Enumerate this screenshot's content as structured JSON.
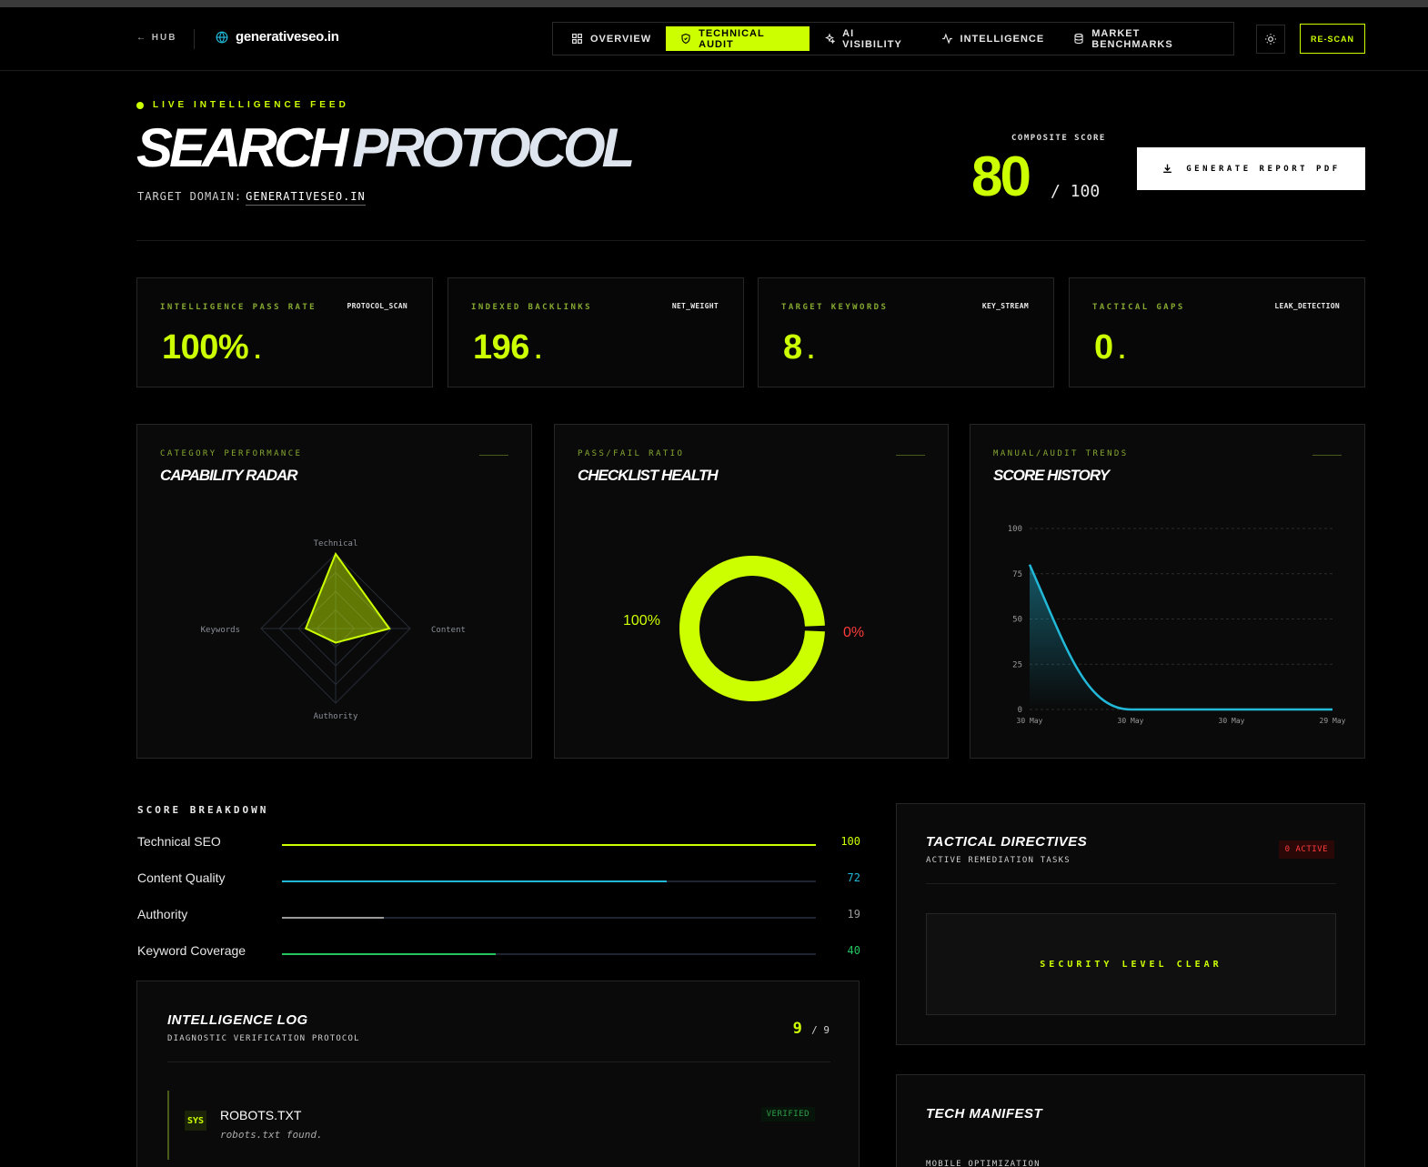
{
  "header": {
    "hub_label": "← HUB",
    "domain": "generativeseo.in",
    "nav": [
      {
        "label": "OVERVIEW",
        "icon": "grid-icon"
      },
      {
        "label": "TECHNICAL AUDIT",
        "icon": "shield-check-icon",
        "active": true
      },
      {
        "label": "AI VISIBILITY",
        "icon": "sparkles-icon"
      },
      {
        "label": "INTELLIGENCE",
        "icon": "activity-icon"
      },
      {
        "label": "MARKET BENCHMARKS",
        "icon": "database-icon"
      }
    ],
    "theme_icon": "sun-icon",
    "rescan_label": "RE-SCAN"
  },
  "hero": {
    "live_label": "LIVE INTELLIGENCE FEED",
    "title_word1": "SEARCH",
    "title_word2": "PROTOCOL",
    "target_label": "TARGET DOMAIN:",
    "target_domain": "GENERATIVESEO.IN",
    "composite_label": "COMPOSITE SCORE",
    "composite_score": "80",
    "composite_max": "/ 100",
    "report_button": "GENERATE REPORT PDF"
  },
  "stats": [
    {
      "label": "INTELLIGENCE PASS RATE",
      "tag": "PROTOCOL_SCAN",
      "value": "100%"
    },
    {
      "label": "INDEXED BACKLINKS",
      "tag": "NET_WEIGHT",
      "value": "196"
    },
    {
      "label": "TARGET KEYWORDS",
      "tag": "KEY_STREAM",
      "value": "8"
    },
    {
      "label": "TACTICAL GAPS",
      "tag": "LEAK_DETECTION",
      "value": "0"
    }
  ],
  "panels": {
    "radar": {
      "label": "CATEGORY PERFORMANCE",
      "title": "CAPABILITY RADAR"
    },
    "donut": {
      "label": "PASS/FAIL RATIO",
      "title": "CHECKLIST HEALTH"
    },
    "history": {
      "label": "MANUAL/AUDIT TRENDS",
      "title": "SCORE HISTORY"
    }
  },
  "chart_data": [
    {
      "type": "radar",
      "categories": [
        "Technical",
        "Content",
        "Authority",
        "Keywords"
      ],
      "values": [
        100,
        72,
        19,
        40
      ],
      "range": [
        0,
        100
      ],
      "grid_rings": 4,
      "color": "#ccff00"
    },
    {
      "type": "pie",
      "categories": [
        "Pass",
        "Fail"
      ],
      "values": [
        100,
        0
      ],
      "labels": [
        "100%",
        "0%"
      ],
      "colors": [
        "#ccff00",
        "#ff3b3b"
      ]
    },
    {
      "type": "area",
      "x": [
        "30 May",
        "30 May",
        "30 May",
        "29 May"
      ],
      "y": [
        80,
        0,
        0,
        0
      ],
      "ylim": [
        0,
        100
      ],
      "yticks": [
        0,
        25,
        50,
        75,
        100
      ],
      "grid": true,
      "color": "#22b8d8"
    }
  ],
  "breakdown": {
    "title": "SCORE BREAKDOWN",
    "rows": [
      {
        "name": "Technical SEO",
        "value": 100,
        "color": "#ccff00"
      },
      {
        "name": "Content Quality",
        "value": 72,
        "color": "#22b8d8"
      },
      {
        "name": "Authority",
        "value": 19,
        "color": "#9a9a9a"
      },
      {
        "name": "Keyword Coverage",
        "value": 40,
        "color": "#22c55e"
      }
    ]
  },
  "log": {
    "title": "INTELLIGENCE LOG",
    "subtitle": "DIAGNOSTIC VERIFICATION PROTOCOL",
    "count": "9",
    "total": "/ 9",
    "items": [
      {
        "tag": "SYS",
        "title": "ROBOTS.TXT",
        "desc": "robots.txt found.",
        "status": "VERIFIED"
      }
    ]
  },
  "tactical": {
    "title": "TACTICAL DIRECTIVES",
    "subtitle": "ACTIVE REMEDIATION TASKS",
    "badge": "0 ACTIVE",
    "status": "SECURITY LEVEL CLEAR"
  },
  "manifest": {
    "title": "TECH MANIFEST",
    "subtitle": "MOBILE OPTIMIZATION"
  }
}
